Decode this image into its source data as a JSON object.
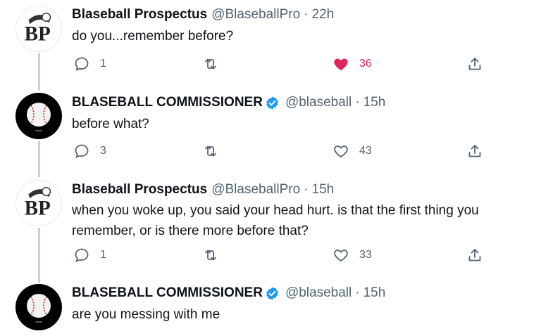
{
  "tweets": [
    {
      "name": "Blaseball Prospectus",
      "handle": "@BlaseballPro",
      "sep": "·",
      "time": "22h",
      "text": "do you...remember before?",
      "verified": false,
      "avatar": "blaseball-prospectus-logo",
      "avatar_text": "BP",
      "replies": "1",
      "retweets": "",
      "likes": "36",
      "liked": true
    },
    {
      "name": "BLASEBALL COMMISSIONER",
      "handle": "@blaseball",
      "sep": "·",
      "time": "15h",
      "text": "before what?",
      "verified": true,
      "avatar": "baseball-logo",
      "replies": "3",
      "retweets": "",
      "likes": "43",
      "liked": false
    },
    {
      "name": "Blaseball Prospectus",
      "handle": "@BlaseballPro",
      "sep": "·",
      "time": "15h",
      "text": "when you woke up, you said your head hurt. is that the first thing you remember, or is there more before that?",
      "verified": false,
      "avatar": "blaseball-prospectus-logo",
      "avatar_text": "BP",
      "replies": "1",
      "retweets": "",
      "likes": "33",
      "liked": false
    },
    {
      "name": "BLASEBALL COMMISSIONER",
      "handle": "@blaseball",
      "sep": "·",
      "time": "15h",
      "text": "are you messing with me",
      "verified": true,
      "avatar": "baseball-logo"
    }
  ],
  "colors": {
    "like_active": "#e0245e",
    "verified": "#1d9bf0",
    "secondary_text": "#536471",
    "thread_line": "#c4cfd6"
  }
}
